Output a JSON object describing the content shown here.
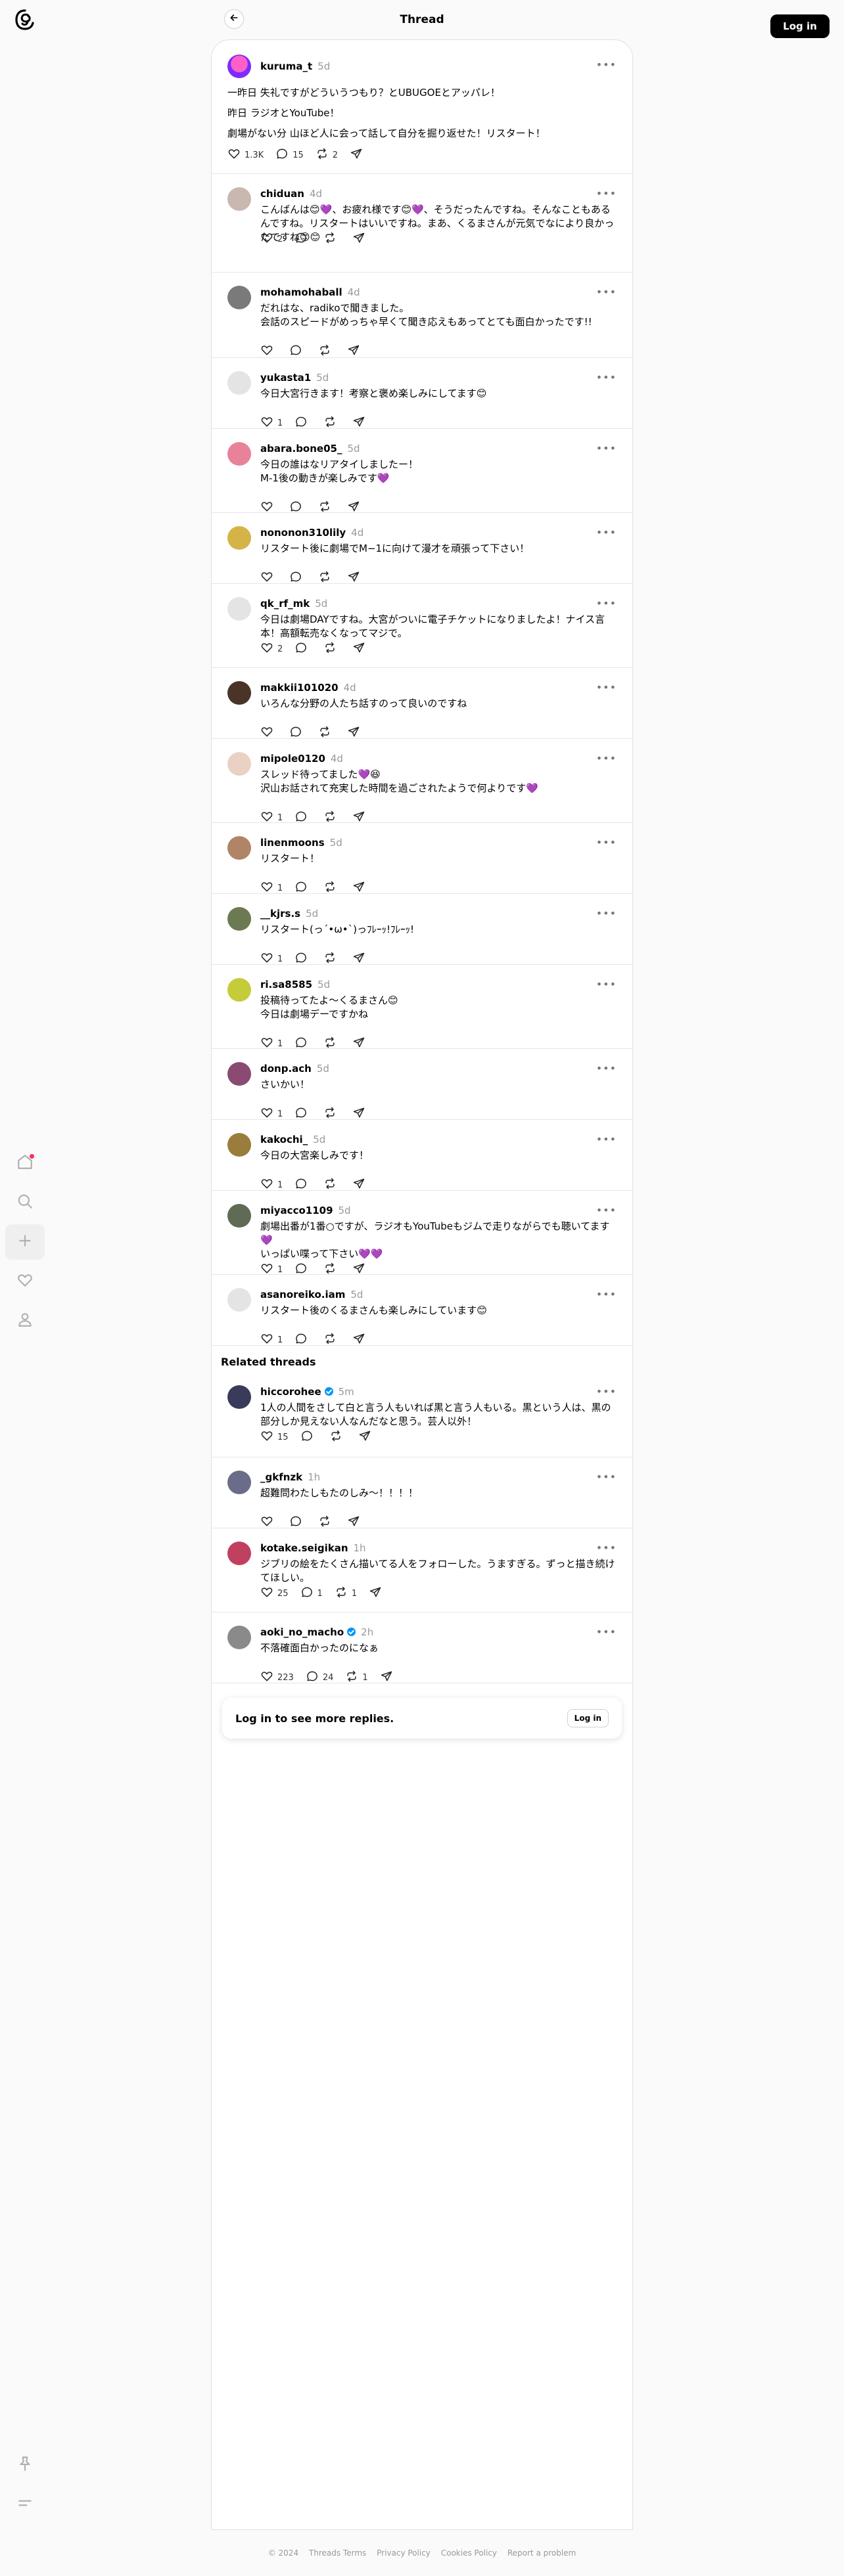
{
  "header": {
    "title": "Thread",
    "login_label": "Log in"
  },
  "main_post": {
    "username": "kuruma_t",
    "time": "5d",
    "lines": [
      "一昨日 失礼ですがどういうつもり？とUBUGOEとアッパレ！",
      "昨日 ラジオとYouTube！",
      "劇場がない分 山ほど人に会って話して自分を掘り返せた！リスタート！"
    ],
    "likes": "1.3K",
    "comments": "15",
    "reposts": "2"
  },
  "replies": [
    {
      "username": "chiduan",
      "time": "4d",
      "text": [
        "こんばんは😊💜、お疲れ様です😊💜、そうだったんですね。そんなこともあるんですね。リスタートはいいですね。まあ、くるまさんが元気でなにより良かったですね😊😊"
      ],
      "likes": "2",
      "comments": "",
      "reposts": "",
      "avatar_color": "#c9b8b0"
    },
    {
      "username": "mohamohaball",
      "time": "4d",
      "text": [
        "だれはな、radikoで聞きました。",
        "会話のスピードがめっちゃ早くて聞き応えもあってとても面白かったです!!"
      ],
      "likes": "",
      "comments": "",
      "reposts": "",
      "avatar_color": "#7a7a7a"
    },
    {
      "username": "yukasta1",
      "time": "5d",
      "text": [
        "今日大宮行きます！考察と褒め楽しみにしてます😊"
      ],
      "likes": "1",
      "comments": "",
      "reposts": "",
      "avatar_color": "#e4e4e4"
    },
    {
      "username": "abara.bone05_",
      "time": "5d",
      "text": [
        "今日の誰はなリアタイしましたー！",
        "M-1後の動きが楽しみです💜"
      ],
      "likes": "",
      "comments": "",
      "reposts": "",
      "avatar_color": "#e8829a"
    },
    {
      "username": "nononon310lily",
      "time": "4d",
      "text": [
        "リスタート後に劇場でM−1に向けて漫才を頑張って下さい！"
      ],
      "likes": "",
      "comments": "",
      "reposts": "",
      "avatar_color": "#d6b347"
    },
    {
      "username": "qk_rf_mk",
      "time": "5d",
      "text": [
        "今日は劇場DAYですね。大宮がついに電子チケットになりましたよ！ナイス言本！高額転売なくなってマジで。"
      ],
      "likes": "2",
      "comments": "",
      "reposts": "",
      "avatar_color": "#e4e4e4"
    },
    {
      "username": "makkii101020",
      "time": "4d",
      "text": [
        "いろんな分野の人たち話すのって良いのですね"
      ],
      "likes": "",
      "comments": "",
      "reposts": "",
      "avatar_color": "#4a3428"
    },
    {
      "username": "mipole0120",
      "time": "4d",
      "text": [
        "スレッド待ってました💜😆",
        "沢山お話されて充実した時間を過ごされたようで何よりです💜"
      ],
      "likes": "1",
      "comments": "",
      "reposts": "",
      "avatar_color": "#e9d2c4"
    },
    {
      "username": "linenmoons",
      "time": "5d",
      "text": [
        "リスタート！"
      ],
      "likes": "1",
      "comments": "",
      "reposts": "",
      "avatar_color": "#b08466"
    },
    {
      "username": "__kjrs.s",
      "time": "5d",
      "text": [
        "リスタート(っ´•ω•`)っﾌﾚｰｯ!ﾌﾚｰｯ!"
      ],
      "likes": "1",
      "comments": "",
      "reposts": "",
      "avatar_color": "#6c7a52"
    },
    {
      "username": "ri.sa8585",
      "time": "5d",
      "text": [
        "投稿待ってたよ〜くるまさん😊",
        "今日は劇場デーですかね"
      ],
      "likes": "1",
      "comments": "",
      "reposts": "",
      "avatar_color": "#c5cc3a"
    },
    {
      "username": "donp.ach",
      "time": "5d",
      "text": [
        "さいかい！"
      ],
      "likes": "1",
      "comments": "",
      "reposts": "",
      "avatar_color": "#8a4a72"
    },
    {
      "username": "kakochi_",
      "time": "5d",
      "text": [
        "今日の大宮楽しみです！"
      ],
      "likes": "1",
      "comments": "",
      "reposts": "",
      "avatar_color": "#9a7c3c"
    },
    {
      "username": "miyacco1109",
      "time": "5d",
      "text": [
        "劇場出番が1番○ですが、ラジオもYouTubeもジムで走りながらでも聴いてます💜",
        "いっぱい喋って下さい💜💜"
      ],
      "likes": "1",
      "comments": "",
      "reposts": "",
      "avatar_color": "#5f6b55"
    },
    {
      "username": "asanoreiko.iam",
      "time": "5d",
      "text": [
        "リスタート後のくるまさんも楽しみにしています😊"
      ],
      "likes": "1",
      "comments": "",
      "reposts": "",
      "avatar_color": "#e4e4e4"
    }
  ],
  "related": {
    "title": "Related threads",
    "items": [
      {
        "username": "hiccorohee",
        "verified": true,
        "time": "5m",
        "text": [
          "1人の人間をさして白と言う人もいれば黒と言う人もいる。黒という人は、黒の部分しか見えない人なんだなと思う。芸人以外！"
        ],
        "likes": "15",
        "comments": "",
        "reposts": "",
        "avatar_color": "#3a3a5a"
      },
      {
        "username": "_gkfnzk",
        "verified": false,
        "time": "1h",
        "text": [
          "超難問わたしもたのしみ〜！！！！"
        ],
        "likes": "",
        "comments": "",
        "reposts": "",
        "avatar_color": "#6b6b8a"
      },
      {
        "username": "kotake.seigikan",
        "verified": false,
        "time": "1h",
        "text": [
          "ジブリの絵をたくさん描いてる人をフォローした。うますぎる。ずっと描き続けてほしい。"
        ],
        "likes": "25",
        "comments": "1",
        "reposts": "1",
        "avatar_color": "#c04060"
      },
      {
        "username": "aoki_no_macho",
        "verified": true,
        "time": "2h",
        "text": [
          "不落確面白かったのになぁ"
        ],
        "likes": "223",
        "comments": "24",
        "reposts": "1",
        "avatar_color": "#8a8a8a"
      }
    ]
  },
  "login_prompt": {
    "text": "Log in to see more replies.",
    "button": "Log in"
  },
  "footer": [
    "© 2024",
    "Threads Terms",
    "Privacy Policy",
    "Cookies Policy",
    "Report a problem"
  ],
  "icons": {
    "logo": "threads-logo-icon",
    "back": "arrow-left-icon",
    "more": "more-icon",
    "like": "heart-icon",
    "comment": "comment-icon",
    "repost": "repost-icon",
    "share": "send-icon"
  },
  "colors": {
    "accent": "#0095f6",
    "notification": "#ff2d55"
  }
}
